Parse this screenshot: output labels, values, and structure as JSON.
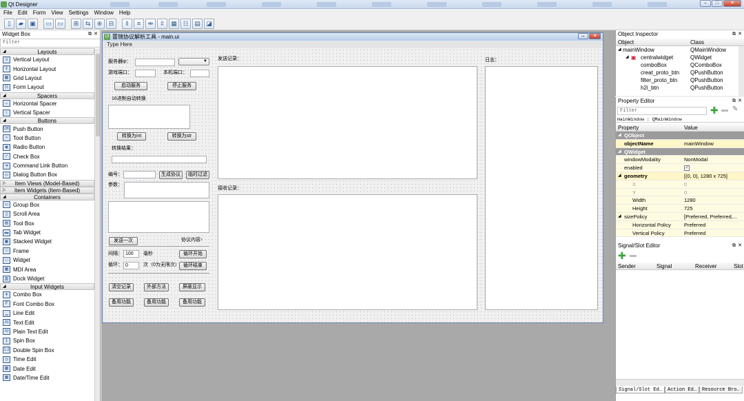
{
  "window": {
    "title": "Qt Designer"
  },
  "menu": [
    "File",
    "Edit",
    "Form",
    "View",
    "Settings",
    "Window",
    "Help"
  ],
  "widget_box": {
    "title": "Widget Box",
    "filter_placeholder": "Filter",
    "categories": [
      {
        "name": "Layouts",
        "items": [
          "Vertical Layout",
          "Horizontal Layout",
          "Grid Layout",
          "Form Layout"
        ]
      },
      {
        "name": "Spacers",
        "items": [
          "Horizontal Spacer",
          "Vertical Spacer"
        ]
      },
      {
        "name": "Buttons",
        "items": [
          "Push Button",
          "Tool Button",
          "Radio Button",
          "Check Box",
          "Command Link Button",
          "Dialog Button Box"
        ]
      },
      {
        "name": "Item Views (Model-Based)",
        "items": [],
        "collapsed": true
      },
      {
        "name": "Item Widgets (Item-Based)",
        "items": [],
        "collapsed": true
      },
      {
        "name": "Containers",
        "items": [
          "Group Box",
          "Scroll Area",
          "Tool Box",
          "Tab Widget",
          "Stacked Widget",
          "Frame",
          "Widget",
          "MDI Area",
          "Dock Widget"
        ]
      },
      {
        "name": "Input Widgets",
        "items": [
          "Combo Box",
          "Font Combo Box",
          "Line Edit",
          "Text Edit",
          "Plain Text Edit",
          "Spin Box",
          "Double Spin Box",
          "Time Edit",
          "Date Edit",
          "Date/Time Edit"
        ]
      }
    ]
  },
  "form": {
    "title": "蕾锦协议解析工具 - main.ui",
    "type_here": "Type Here",
    "server_ip_label": "服务器ip：",
    "game_port_label": "游戏端口：",
    "local_port_label": "本机端口：",
    "start_service": "启动服务",
    "stop_service": "停止服务",
    "hex_convert_label": "16进制自动转换",
    "to_int": "转换为int",
    "to_str": "转换为str",
    "convert_result_label": "转换结果：",
    "id_label": "编号：",
    "generate_proto": "生成协议",
    "temp_filter": "临时过滤",
    "params_label": "参数：",
    "send_once": "发送一次",
    "proto_content": "协议内容↑",
    "interval_label": "间隔：",
    "interval_value": "100",
    "ms_label": "毫秒",
    "loop_start": "循环开始",
    "loop_label": "循环：",
    "loop_value": "0",
    "loop_hint": "次（0为无限次）",
    "loop_end": "循环结束",
    "clear_records": "清空记录",
    "external_method": "外部方法",
    "mask_display": "屏蔽显示",
    "spare1": "备用功能",
    "spare2": "备用功能",
    "spare3": "备用功能",
    "send_log_label": "发送记录：",
    "recv_log_label": "接收记录：",
    "log_label": "日志："
  },
  "object_inspector": {
    "title": "Object Inspector",
    "col_object": "Object",
    "col_class": "Class",
    "rows": [
      {
        "object": "mainWindow",
        "class": "QMainWindow"
      },
      {
        "object": "centralwidget",
        "class": "QWidget"
      },
      {
        "object": "comboBox",
        "class": "QComboBox"
      },
      {
        "object": "creat_proto_btn",
        "class": "QPushButton"
      },
      {
        "object": "filter_proto_btn",
        "class": "QPushButton"
      },
      {
        "object": "h2i_btn",
        "class": "QPushButton"
      }
    ]
  },
  "property_editor": {
    "title": "Property Editor",
    "filter_placeholder": "Filter",
    "context": "mainWindow : QMainWindow",
    "col_property": "Property",
    "col_value": "Value",
    "rows": [
      {
        "name": "QObject",
        "value": "",
        "kind": "group"
      },
      {
        "name": "objectName",
        "value": "mainWindow",
        "kind": "bold"
      },
      {
        "name": "QWidget",
        "value": "",
        "kind": "group"
      },
      {
        "name": "windowModality",
        "value": "NonModal",
        "kind": "normal"
      },
      {
        "name": "enabled",
        "value": "✓",
        "kind": "normal"
      },
      {
        "name": "geometry",
        "value": "[(0, 0), 1280 x 725]",
        "kind": "bold"
      },
      {
        "name": "X",
        "value": "0",
        "kind": "sub"
      },
      {
        "name": "Y",
        "value": "0",
        "kind": "sub"
      },
      {
        "name": "Width",
        "value": "1280",
        "kind": "sub"
      },
      {
        "name": "Height",
        "value": "725",
        "kind": "sub"
      },
      {
        "name": "sizePolicy",
        "value": "[Preferred, Preferred,...",
        "kind": "normal"
      },
      {
        "name": "Horizontal Policy",
        "value": "Preferred",
        "kind": "sub"
      },
      {
        "name": "Vertical Policy",
        "value": "Preferred",
        "kind": "sub"
      }
    ]
  },
  "signal_slot": {
    "title": "Signal/Slot Editor",
    "cols": [
      "Sender",
      "Signal",
      "Receiver",
      "Slot"
    ]
  },
  "bottom_tabs": [
    "Signal/Slot Ed…",
    "Action Ed…",
    "Resource Bro…"
  ]
}
